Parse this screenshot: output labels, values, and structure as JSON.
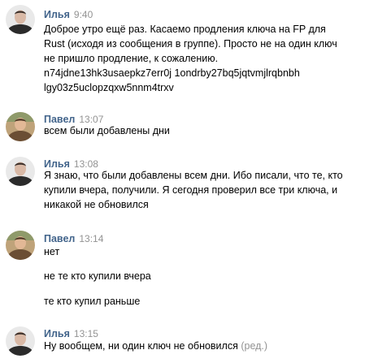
{
  "messages": [
    {
      "author": "Илья",
      "time": "9:40",
      "lines": [
        "Доброе утро ещё раз. Касаемо продления ключа на FP для",
        "Rust (исходя из сообщения в группе). Просто не на один ключ",
        "не пришло продление, к сожалению.",
        "n74jdne13hk3usaepkz7err0j 1ondrby27bq5jqtvmjlrqbnbh",
        "lgy03z5uclopzqxw5nnm4trxv"
      ]
    },
    {
      "author": "Павел",
      "time": "13:07",
      "lines": [
        "всем были добавлены дни"
      ]
    },
    {
      "author": "Илья",
      "time": "13:08",
      "lines": [
        "Я знаю, что были добавлены всем дни. Ибо писали, что те, кто",
        "купили вчера, получили. Я сегодня проверил все три ключа, и",
        "никакой не обновился"
      ]
    },
    {
      "author": "Павел",
      "time": "13:14",
      "lines": [
        "нет",
        "не те кто купили вчера",
        "те кто купил раньше"
      ]
    },
    {
      "author": "Илья",
      "time": "13:15",
      "lines": [
        "Ну вообщем, ни один ключ не обновился"
      ],
      "edited_label": "(ред.)"
    }
  ],
  "colors": {
    "author": "#42648b",
    "time": "#939393",
    "text": "#000000",
    "edited": "#939393"
  }
}
